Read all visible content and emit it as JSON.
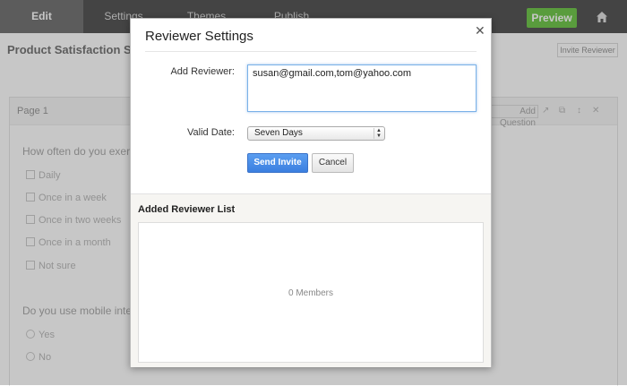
{
  "topbar": {
    "tabs": [
      {
        "label": "Edit"
      },
      {
        "label": "Settings"
      },
      {
        "label": "Themes"
      },
      {
        "label": "Publish"
      }
    ],
    "preview_label": "Preview"
  },
  "survey": {
    "title": "Product Satisfaction Survey",
    "invite_label": "Invite Reviewer"
  },
  "page": {
    "label": "Page 1",
    "add_question_label": "Add Question",
    "questions": [
      {
        "text": "How often do you exercise?",
        "options": [
          "Daily",
          "Once in a week",
          "Once in two weeks",
          "Once in a month",
          "Not sure"
        ]
      },
      {
        "text": "Do you use mobile internet?",
        "options": [
          "Yes",
          "No"
        ]
      }
    ]
  },
  "modal": {
    "title": "Reviewer Settings",
    "add_reviewer_label": "Add Reviewer:",
    "add_reviewer_value": "susan@gmail.com,tom@yahoo.com",
    "valid_date_label": "Valid Date:",
    "valid_date_value": "Seven Days",
    "send_label": "Send Invite",
    "cancel_label": "Cancel",
    "list_heading": "Added Reviewer List",
    "list_empty": "0 Members"
  },
  "colors": {
    "primary_button": "#3b7fe0",
    "preview_button": "#73c84f"
  }
}
